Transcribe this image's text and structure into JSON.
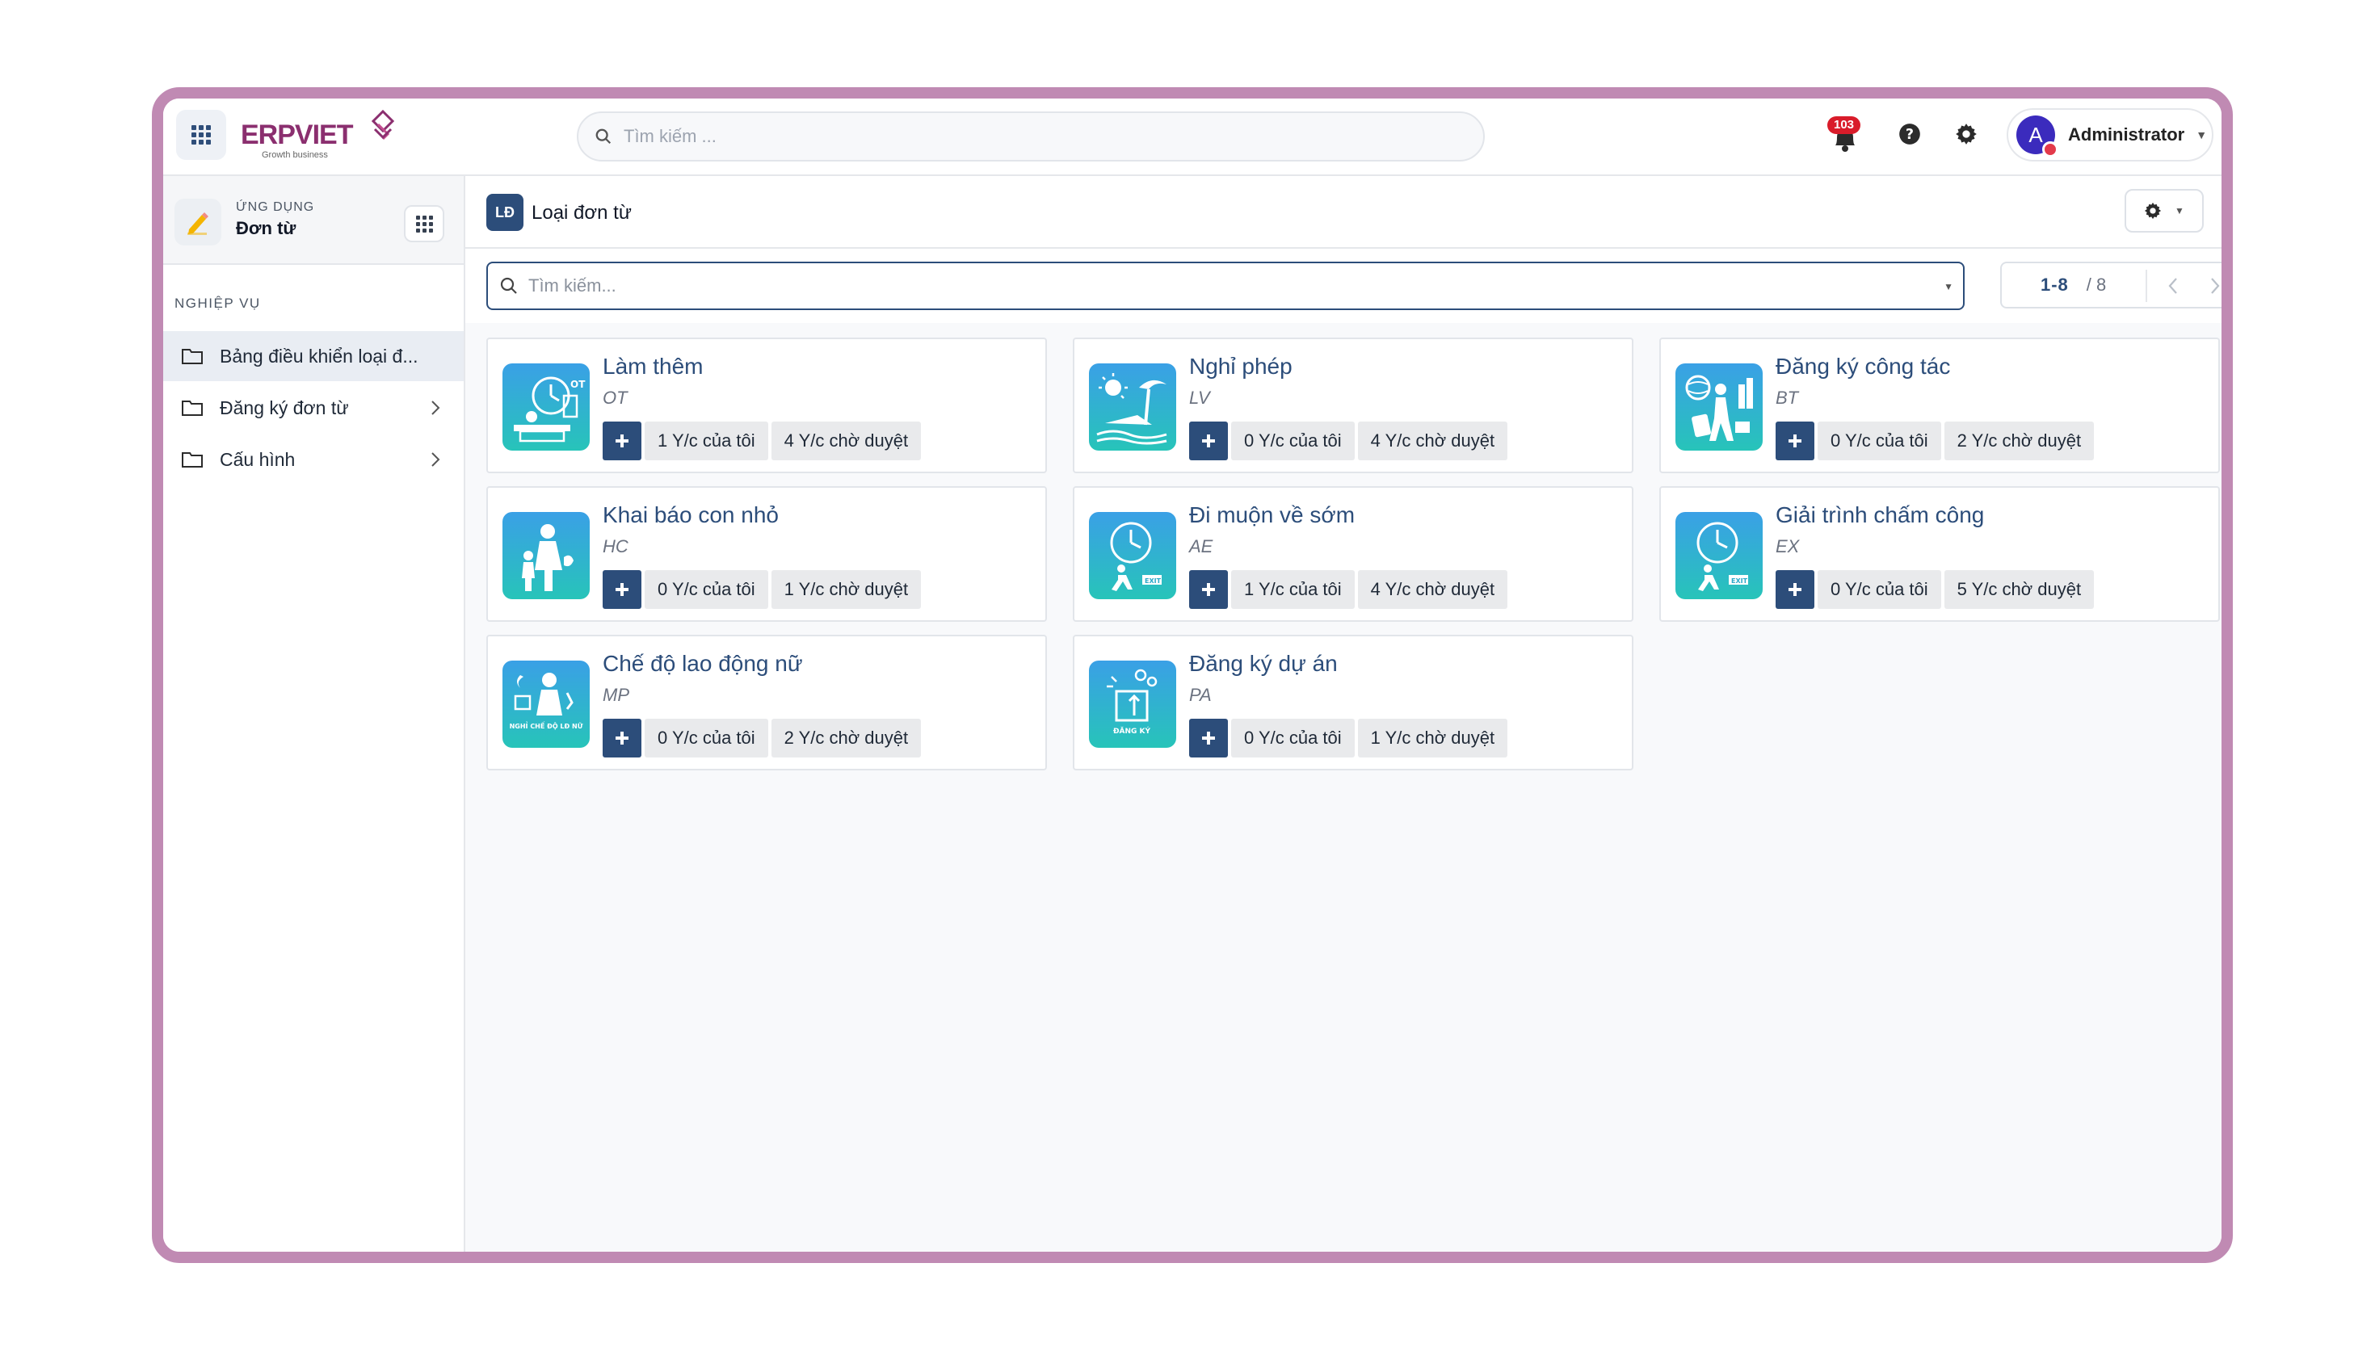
{
  "logo": {
    "brand": "ERPVIET",
    "tagline": "Growth business"
  },
  "topbar": {
    "search_placeholder": "Tìm kiếm ...",
    "notification_count": "103",
    "user_initial": "A",
    "user_name": "Administrator"
  },
  "sidebar": {
    "app_label": "ỨNG DỤNG",
    "app_name": "Đơn từ",
    "section_label": "NGHIỆP VỤ",
    "items": [
      {
        "label": "Bảng điều khiển loại đ...",
        "active": true,
        "has_children": false
      },
      {
        "label": "Đăng ký đơn từ",
        "active": false,
        "has_children": true
      },
      {
        "label": "Cấu hình",
        "active": false,
        "has_children": true
      }
    ]
  },
  "main": {
    "badge": "LĐ",
    "title": "Loại đơn từ",
    "search_placeholder": "Tìm kiếm...",
    "pager_range": "1-8",
    "pager_total": "/ 8"
  },
  "cards": [
    {
      "title": "Làm thêm",
      "code": "OT",
      "mine": "1 Y/c của tôi",
      "pending": "4 Y/c chờ duyệt",
      "icon": "overtime-clock-icon"
    },
    {
      "title": "Nghỉ phép",
      "code": "LV",
      "mine": "0 Y/c của tôi",
      "pending": "4 Y/c chờ duyệt",
      "icon": "beach-vacation-icon"
    },
    {
      "title": "Đăng ký công tác",
      "code": "BT",
      "mine": "0 Y/c của tôi",
      "pending": "2 Y/c chờ duyệt",
      "icon": "business-trip-icon"
    },
    {
      "title": "Khai báo con nhỏ",
      "code": "HC",
      "mine": "0 Y/c của tôi",
      "pending": "1 Y/c chờ duyệt",
      "icon": "mother-child-icon"
    },
    {
      "title": "Đi muộn về sớm",
      "code": "AE",
      "mine": "1 Y/c của tôi",
      "pending": "4 Y/c chờ duyệt",
      "icon": "late-early-clock-icon"
    },
    {
      "title": "Giải trình chấm công",
      "code": "EX",
      "mine": "0 Y/c của tôi",
      "pending": "5 Y/c chờ duyệt",
      "icon": "attendance-explanation-icon"
    },
    {
      "title": "Chế độ lao động nữ",
      "code": "MP",
      "mine": "0 Y/c của tôi",
      "pending": "2 Y/c chờ duyệt",
      "icon": "female-labor-icon",
      "icon_caption": "NGHỈ CHẾ ĐỘ LĐ NỮ"
    },
    {
      "title": "Đăng ký dự án",
      "code": "PA",
      "mine": "0 Y/c của tôi",
      "pending": "1 Y/c chờ duyệt",
      "icon": "project-register-icon",
      "icon_caption": "ĐĂNG KÝ"
    }
  ],
  "colors": {
    "primary": "#2c4d7a",
    "frame": "#c08ab3",
    "badge_red": "#d91c2a",
    "avatar": "#3b2bbd"
  }
}
